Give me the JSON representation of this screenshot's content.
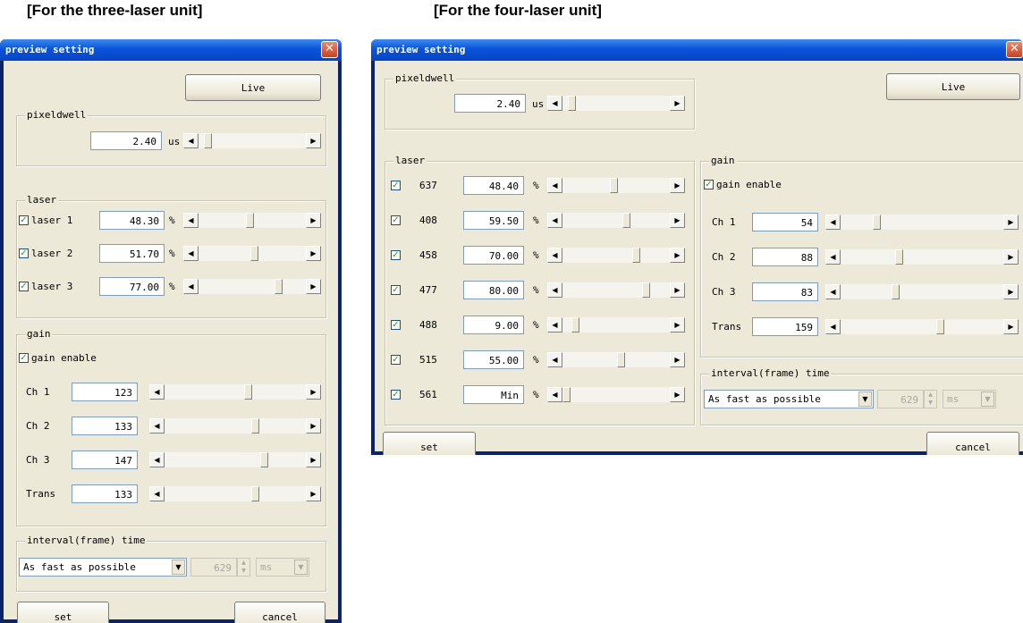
{
  "captions": {
    "three": "[For the three-laser unit]",
    "four": "[For the four-laser unit]"
  },
  "three": {
    "title": "preview setting",
    "close": "✕",
    "live": "Live",
    "pixeldwell": {
      "label": "pixeldwell",
      "value": "2.40",
      "unit": "us",
      "slider": 0.05
    },
    "laser": {
      "label": "laser",
      "rows": [
        {
          "name": "laser 1",
          "checked": true,
          "value": "48.30",
          "unit": "%",
          "slider": 0.48
        },
        {
          "name": "laser 2",
          "checked": true,
          "value": "51.70",
          "unit": "%",
          "slider": 0.52
        },
        {
          "name": "laser 3",
          "checked": true,
          "value": "77.00",
          "unit": "%",
          "slider": 0.77
        }
      ]
    },
    "gain": {
      "label": "gain",
      "enable_label": "gain enable",
      "enabled": true,
      "rows": [
        {
          "name": "Ch 1",
          "value": "123",
          "slider": 0.6
        },
        {
          "name": "Ch 2",
          "value": "133",
          "slider": 0.65
        },
        {
          "name": "Ch 3",
          "value": "147",
          "slider": 0.72
        },
        {
          "name": "Trans",
          "value": "133",
          "slider": 0.65
        }
      ]
    },
    "interval": {
      "label": "interval(frame) time",
      "select": "As fast as possible",
      "number": "629",
      "unit": "ms"
    },
    "set": "set",
    "cancel": "cancel"
  },
  "four": {
    "title": "preview setting",
    "close": "✕",
    "live": "Live",
    "pixeldwell": {
      "label": "pixeldwell",
      "value": "2.40",
      "unit": "us",
      "slider": 0.05
    },
    "laser": {
      "label": "laser",
      "rows": [
        {
          "name": "637",
          "checked": true,
          "value": "48.40",
          "unit": "%",
          "slider": 0.48
        },
        {
          "name": "408",
          "checked": true,
          "value": "59.50",
          "unit": "%",
          "slider": 0.6
        },
        {
          "name": "458",
          "checked": true,
          "value": "70.00",
          "unit": "%",
          "slider": 0.7
        },
        {
          "name": "477",
          "checked": true,
          "value": "80.00",
          "unit": "%",
          "slider": 0.8
        },
        {
          "name": "488",
          "checked": true,
          "value": "9.00",
          "unit": "%",
          "slider": 0.09
        },
        {
          "name": "515",
          "checked": true,
          "value": "55.00",
          "unit": "%",
          "slider": 0.55
        },
        {
          "name": "561",
          "checked": true,
          "value": "Min",
          "unit": "%",
          "slider": 0.0
        }
      ]
    },
    "gain": {
      "label": "gain",
      "enable_label": "gain enable",
      "enabled": true,
      "rows": [
        {
          "name": "Ch 1",
          "value": "54",
          "slider": 0.21
        },
        {
          "name": "Ch 2",
          "value": "88",
          "slider": 0.35
        },
        {
          "name": "Ch 3",
          "value": "83",
          "slider": 0.33
        },
        {
          "name": "Trans",
          "value": "159",
          "slider": 0.62
        }
      ]
    },
    "interval": {
      "label": "interval(frame) time",
      "select": "As fast as possible",
      "number": "629",
      "unit": "ms"
    },
    "set": "set",
    "cancel": "cancel"
  }
}
